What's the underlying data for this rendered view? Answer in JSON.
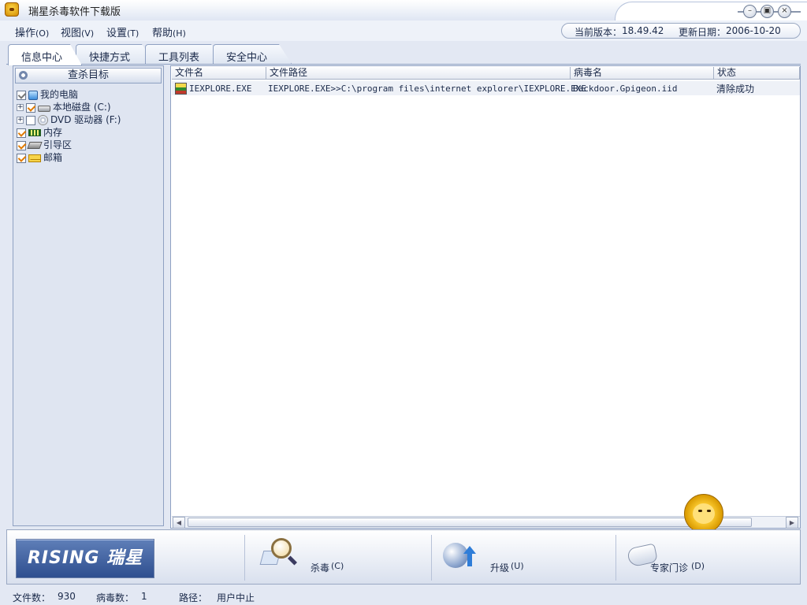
{
  "window": {
    "title": "瑞星杀毒软件下载版",
    "min": "–",
    "max": "▣",
    "close": "×"
  },
  "menu": [
    {
      "label": "操作",
      "hotkey": "(O)"
    },
    {
      "label": "视图",
      "hotkey": "(V)"
    },
    {
      "label": "设置",
      "hotkey": "(T)"
    },
    {
      "label": "帮助",
      "hotkey": "(H)"
    }
  ],
  "version": {
    "label": "当前版本：",
    "value": "18.49.42",
    "date_label": "更新日期：",
    "date_value": "2006-10-20"
  },
  "tabs": [
    "信息中心",
    "快捷方式",
    "工具列表",
    "安全中心"
  ],
  "active_tab": "信息中心",
  "left_panel": {
    "header": "查杀目标",
    "tree": [
      {
        "label": "我的电脑",
        "icon": "computer-icon",
        "checked": true
      },
      {
        "label": "本地磁盘 (C:)",
        "icon": "hard-drive-icon",
        "checked": true,
        "expandable": true
      },
      {
        "label": "DVD 驱动器 (F:)",
        "icon": "dvd-drive-icon",
        "checked": false,
        "expandable": true
      },
      {
        "label": "内存",
        "icon": "memory-icon",
        "checked": true
      },
      {
        "label": "引导区",
        "icon": "boot-sector-icon",
        "checked": true
      },
      {
        "label": "邮箱",
        "icon": "mailbox-icon",
        "checked": true
      }
    ]
  },
  "results": {
    "columns": [
      "文件名",
      "文件路径",
      "病毒名",
      "状态"
    ],
    "rows": [
      {
        "file": "IEXPLORE.EXE",
        "path": "IEXPLORE.EXE>>C:\\program files\\internet explorer\\IEXPLORE.EXE",
        "virus": "Backdoor.Gpigeon.iid",
        "status": "清除成功"
      }
    ]
  },
  "toolbar": {
    "brand": "RISING 瑞星",
    "scan": "杀毒",
    "scan_hotkey": "(C)",
    "update": "升级",
    "update_hotkey": "(U)",
    "expert": "专家门诊",
    "expert_hotkey": "(D)"
  },
  "status": {
    "files_label": "文件数：",
    "files_value": "930",
    "virus_label": "病毒数：",
    "virus_value": "1",
    "path_label": "路径：",
    "path_value": "用户中止"
  }
}
